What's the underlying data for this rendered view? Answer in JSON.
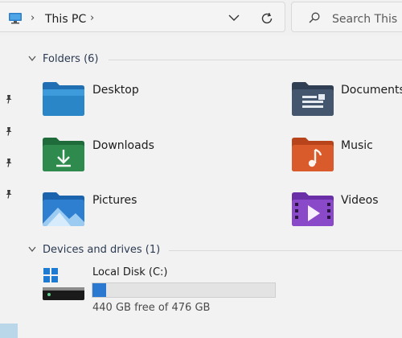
{
  "address_bar": {
    "location": "This PC",
    "search_placeholder": "Search This PC"
  },
  "sections": {
    "folders": {
      "title": "Folders (6)"
    },
    "drives": {
      "title": "Devices and drives (1)"
    }
  },
  "folders": [
    {
      "label": "Desktop",
      "icon": "desktop-folder-icon"
    },
    {
      "label": "Documents",
      "icon": "documents-folder-icon"
    },
    {
      "label": "Downloads",
      "icon": "downloads-folder-icon"
    },
    {
      "label": "Music",
      "icon": "music-folder-icon"
    },
    {
      "label": "Pictures",
      "icon": "pictures-folder-icon"
    },
    {
      "label": "Videos",
      "icon": "videos-folder-icon"
    }
  ],
  "drive": {
    "name": "Local Disk (C:)",
    "free_text": "440 GB free of 476 GB",
    "used_fraction": 0.076,
    "bar_color": "#2a78d0"
  },
  "colors": {
    "desktop": "#2b86c8",
    "documents": "#44566e",
    "downloads": "#2e8a4d",
    "music": "#d95a2a",
    "pictures": "#2f7fd0",
    "videos": "#8a49c9"
  }
}
